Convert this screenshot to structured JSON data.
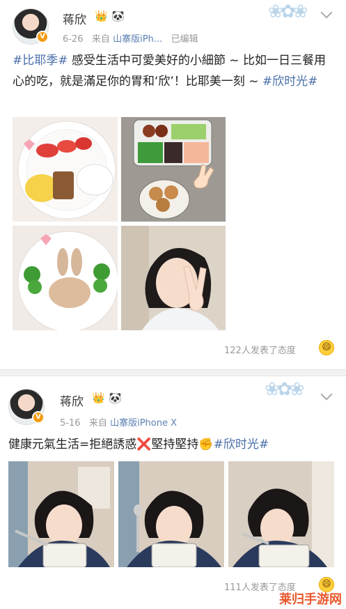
{
  "posts": [
    {
      "user": "蒋欣",
      "emoji1": "👑",
      "emoji2": "🐼",
      "date": "6-26",
      "source_prefix": "来自",
      "source": "山寨版iPh...",
      "edited": "已编辑",
      "text": {
        "tag1": "#比耶季#",
        "body": " 感受生活中可愛美好的小細節 ~ 比如一日三餐用心的吃，就是滿足你的胃和‘欣’！比耶美一刻 ~ ",
        "tag2": "#欣时光#"
      },
      "reaction": "122人发表了态度"
    },
    {
      "user": "蒋欣",
      "emoji1": "👑",
      "emoji2": "🐼",
      "date": "5-16",
      "source_prefix": "来自",
      "source": "山寨版iPhone X",
      "text": {
        "body": "健康元氣生活=拒絕誘惑",
        "cross": "❌",
        "body2": "堅持堅持",
        "fist": "✊",
        "tag": "#欣时光#"
      },
      "reaction": "111人发表了态度"
    }
  ],
  "watermark": "莱归手游网",
  "colors": {
    "link": "#4a6fa8",
    "meta": "#999999",
    "source": "#5b7fb2"
  }
}
